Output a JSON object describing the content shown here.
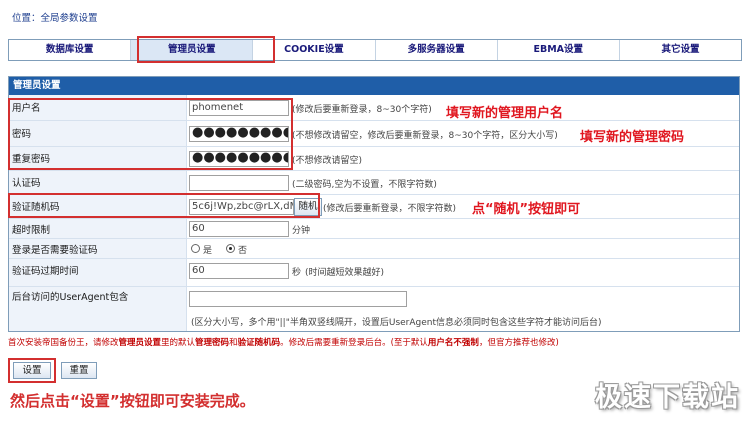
{
  "breadcrumb": "位置：全局参数设置",
  "tabs": [
    "数据库设置",
    "管理员设置",
    "COOKIE设置",
    "多服务器设置",
    "EBMA设置",
    "其它设置"
  ],
  "panel_title": "管理员设置",
  "fields": {
    "username": {
      "label": "用户名",
      "value": "phomenet",
      "hint": "(修改后要重新登录，8~30个字符)"
    },
    "password": {
      "label": "密码",
      "value": "●●●●●●●●●",
      "hint": "(不想修改请留空，修改后要重新登录，8~30个字符，区分大小写)"
    },
    "repassword": {
      "label": "重复密码",
      "value": "●●●●●●●●●",
      "hint": "(不想修改请留空)"
    },
    "authcode": {
      "label": "认证码",
      "value": "",
      "hint": "(二级密码,空为不设置，不限字符数)"
    },
    "random_code": {
      "label": "验证随机码",
      "value": "5c6j!Wp,zbc@rLX,dM\"",
      "button": "随机",
      "hint": "(修改后要重新登录，不限字符数)"
    },
    "timeout": {
      "label": "超时限制",
      "value": "60",
      "unit": "分钟"
    },
    "need_captcha": {
      "label": "登录是否需要验证码",
      "opt_yes": "是",
      "opt_no": "否",
      "selected": "否"
    },
    "captcha_expire": {
      "label": "验证码过期时间",
      "value": "60",
      "unit": "秒",
      "hint": "(时间越短效果越好)"
    },
    "useragent": {
      "label": "后台访问的UserAgent包含",
      "value": "",
      "hint": "(区分大小写，多个用\"||\"半角双竖线隔开，设置后UserAgent信息必须同时包含这些字符才能访问后台)"
    }
  },
  "annotations": {
    "username": "填写新的管理用户名",
    "password": "填写新的管理密码",
    "random": "点“随机”按钮即可",
    "footer": "然后点击“设置”按钮即可安装完成。"
  },
  "notice": {
    "p1": "首次安装帝国备份王，请修改",
    "b1": "管理员设置",
    "p2": "里的默认",
    "b2": "管理密码",
    "p3": "和",
    "b3": "验证随机码",
    "p4": "。修改后需要重新登录后台。(至于默认",
    "b4": "用户名不强制",
    "p5": "，但官方推荐也修改)"
  },
  "buttons": {
    "submit": "设置",
    "reset": "重置"
  },
  "watermark": "极速下载站"
}
